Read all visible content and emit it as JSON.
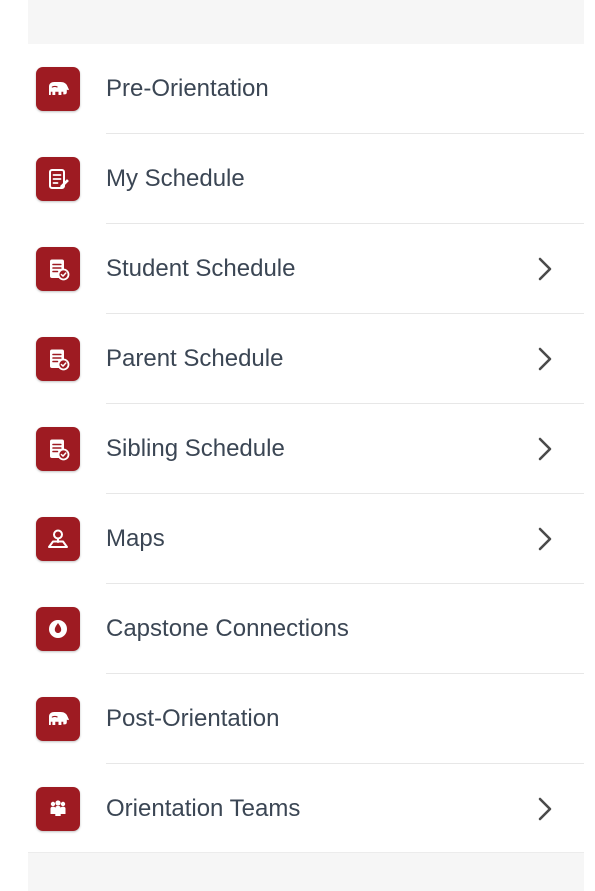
{
  "menu": {
    "items": [
      {
        "label": "Pre-Orientation",
        "icon": "elephant-icon",
        "has_chevron": false
      },
      {
        "label": "My Schedule",
        "icon": "schedule-icon",
        "has_chevron": false
      },
      {
        "label": "Student Schedule",
        "icon": "schedule-badge-icon",
        "has_chevron": true
      },
      {
        "label": "Parent Schedule",
        "icon": "schedule-badge-icon",
        "has_chevron": true
      },
      {
        "label": "Sibling Schedule",
        "icon": "schedule-badge-icon",
        "has_chevron": true
      },
      {
        "label": "Maps",
        "icon": "map-pin-icon",
        "has_chevron": true
      },
      {
        "label": "Capstone Connections",
        "icon": "drop-icon",
        "has_chevron": false
      },
      {
        "label": "Post-Orientation",
        "icon": "elephant-icon",
        "has_chevron": false
      },
      {
        "label": "Orientation Teams",
        "icon": "team-icon",
        "has_chevron": true
      }
    ]
  },
  "colors": {
    "accent": "#9e1b22",
    "label_text": "#3b4654",
    "chevron": "#4a4a4a",
    "divider": "#e7e7e7"
  }
}
